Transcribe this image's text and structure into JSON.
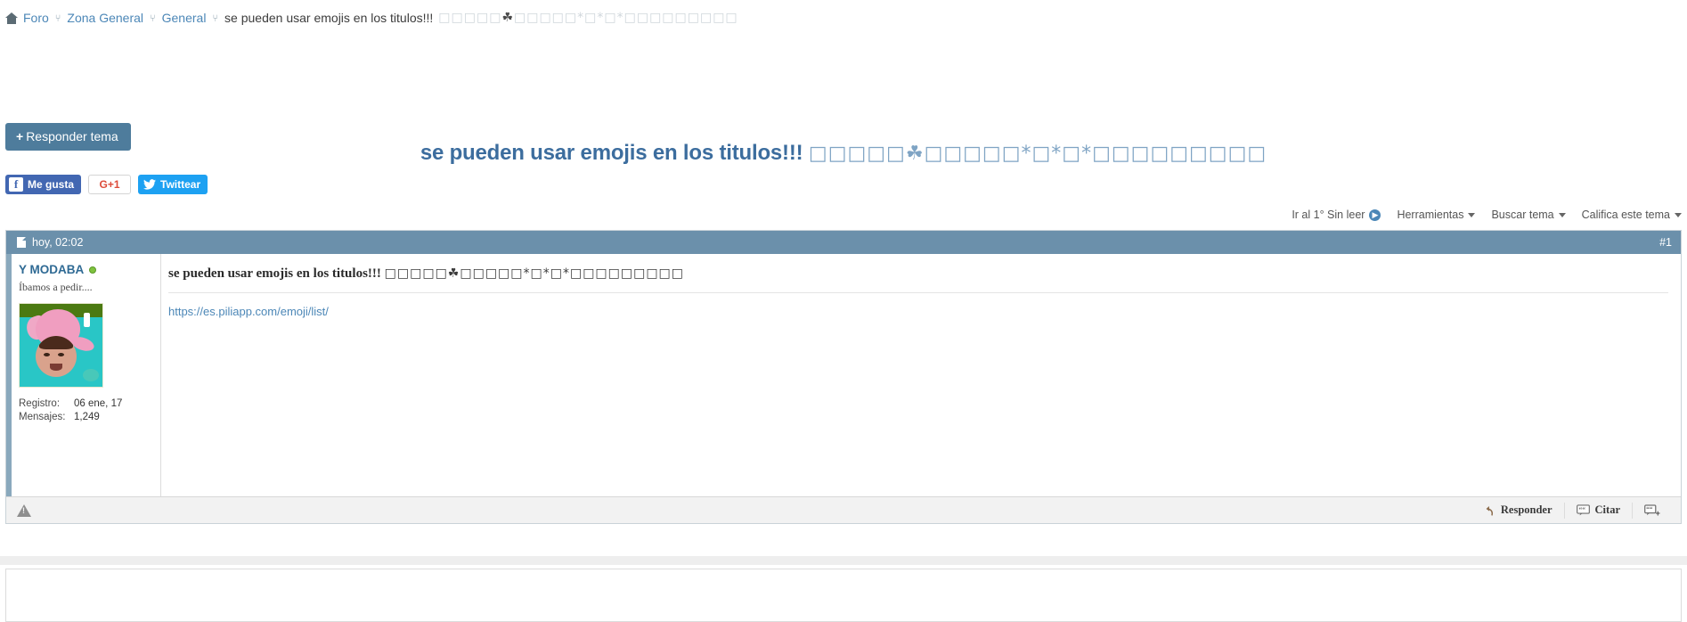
{
  "breadcrumb": {
    "home_icon": "home-icon",
    "separator": "⑂",
    "items": [
      {
        "label": "Foro",
        "link": true
      },
      {
        "label": "Zona General",
        "link": true
      },
      {
        "label": "General",
        "link": true
      }
    ],
    "current": "se pueden usar emojis en los titulos!!!",
    "current_emoji_1": "□□□□□",
    "current_emoji_clover": "☘",
    "current_emoji_2": "□□□□□",
    "current_emoji_3": "*□*□*",
    "current_emoji_4": "□□□□□□□□□"
  },
  "toolbar_top": {
    "reply_thread_label": "Responder tema",
    "reply_plus": "+"
  },
  "title": {
    "text": "se pueden usar emojis en los titulos!!!",
    "emoji_1": "□□□□□",
    "emoji_clover": "☘",
    "emoji_2": "□□□□□",
    "emoji_3": "*□*□*",
    "emoji_4": "□□□□□□□□□"
  },
  "social": {
    "facebook_label": "Me gusta",
    "facebook_icon": "facebook-f-icon",
    "google_label": "G+1",
    "twitter_label": "Twittear",
    "twitter_icon": "twitter-bird-icon"
  },
  "thread_tools": {
    "goto_unread": "Ir al 1° Sin leer",
    "goto_unread_icon": "unread-circle-icon",
    "tools": "Herramientas",
    "search_thread": "Buscar tema",
    "rate_thread": "Califica este tema"
  },
  "post": {
    "timestamp": "hoy, 02:02",
    "timestamp_icon": "document-icon",
    "number": "#1",
    "user": {
      "name": "Y MODABA",
      "online_status": "online",
      "title": "Íbamos a pedir....",
      "avatar_alt": "user-avatar",
      "stats": [
        {
          "label": "Registro:",
          "value": "06 ene, 17"
        },
        {
          "label": "Mensajes:",
          "value": "1,249"
        }
      ]
    },
    "content": {
      "heading": "se pueden usar emojis en los titulos!!!",
      "heading_emoji_1": "□□□□□",
      "heading_emoji_clover": "☘",
      "heading_emoji_2": "□□□□□",
      "heading_emoji_3": "*□*□*",
      "heading_emoji_4": "□□□□□□□□□",
      "link_text": "https://es.piliapp.com/emoji/list/"
    },
    "footer": {
      "report_icon": "warning-triangle-icon",
      "reply_label": "Responder",
      "reply_icon": "reply-arrow-icon",
      "quote_label": "Citar",
      "quote_icon": "quote-bubble-icon",
      "multiquote_icon": "multiquote-plus-icon"
    }
  },
  "colors": {
    "accent_blue": "#4c87b7",
    "title_blue": "#3c6d9e",
    "post_header_blue": "#6b90ab",
    "button_blue": "#4e7c9c",
    "online_green": "#7fc23f",
    "facebook_blue": "#4267b2",
    "twitter_blue": "#1da1f2",
    "google_red": "#dd4b39"
  }
}
